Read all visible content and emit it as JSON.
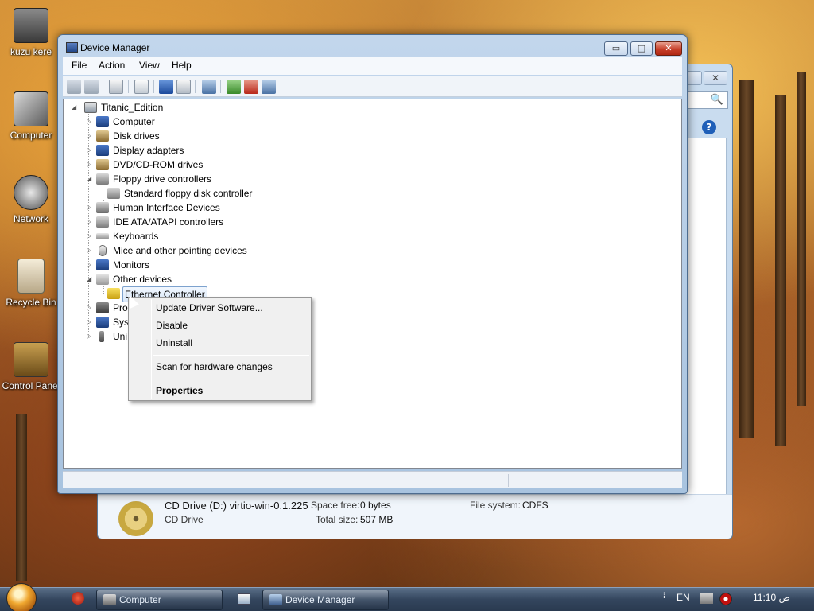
{
  "desktop": {
    "icons": [
      {
        "label": "kuzu kere",
        "icon": "user-folder-icon"
      },
      {
        "label": "Computer",
        "icon": "computer-icon"
      },
      {
        "label": "Network",
        "icon": "network-icon"
      },
      {
        "label": "Recycle Bin",
        "icon": "recycle-bin-icon"
      },
      {
        "label": "Control Panel",
        "icon": "control-panel-icon"
      }
    ]
  },
  "explorer": {
    "search_glyph": "🔍",
    "help_glyph": "?",
    "close_glyph": "✕",
    "details": {
      "drive_name": "CD Drive (D:) virtio-win-0.1.225",
      "drive_type": "CD Drive",
      "space_free_label": "Space free:",
      "space_free_value": "0 bytes",
      "total_size_label": "Total size:",
      "total_size_value": "507 MB",
      "file_system_label": "File system:",
      "file_system_value": "CDFS"
    }
  },
  "device_manager": {
    "title": "Device Manager",
    "buttons": {
      "minimize": "▭",
      "maximize": "□",
      "close": "✕"
    },
    "menu": [
      "File",
      "Action",
      "View",
      "Help"
    ],
    "toolbar_icons": [
      "back-icon",
      "forward-icon",
      "show-hide-console-tree-icon",
      "properties-icon",
      "help-icon",
      "action-pane-icon",
      "scan-hardware-icon",
      "update-driver-icon",
      "uninstall-icon",
      "disable-icon"
    ],
    "tree": {
      "root": "Titanic_Edition",
      "nodes": [
        {
          "label": "Computer",
          "expanded": false
        },
        {
          "label": "Disk drives",
          "expanded": false
        },
        {
          "label": "Display adapters",
          "expanded": false
        },
        {
          "label": "DVD/CD-ROM drives",
          "expanded": false
        },
        {
          "label": "Floppy drive controllers",
          "expanded": true,
          "children": [
            "Standard floppy disk controller"
          ]
        },
        {
          "label": "Human Interface Devices",
          "expanded": false
        },
        {
          "label": "IDE ATA/ATAPI controllers",
          "expanded": false
        },
        {
          "label": "Keyboards",
          "expanded": false
        },
        {
          "label": "Mice and other pointing devices",
          "expanded": false
        },
        {
          "label": "Monitors",
          "expanded": false
        },
        {
          "label": "Other devices",
          "expanded": true,
          "children": [
            "Ethernet Controller"
          ]
        },
        {
          "label": "Pro",
          "expanded": false
        },
        {
          "label": "Sys",
          "expanded": false
        },
        {
          "label": "Uni",
          "expanded": false
        }
      ]
    },
    "selected_device": "Ethernet Controller"
  },
  "context_menu": {
    "items": [
      "Update Driver Software...",
      "Disable",
      "Uninstall",
      "Scan for hardware changes",
      "Properties"
    ]
  },
  "taskbar": {
    "tasks": [
      {
        "label": "Computer",
        "icon": "computer-icon"
      },
      {
        "label": "Device Manager",
        "icon": "device-manager-icon"
      }
    ],
    "language": "EN",
    "clock": "11:10 ص"
  },
  "colors": {
    "accent": "#4d6c8f",
    "selection": "#dbe9fa",
    "close_red": "#c7402a"
  }
}
